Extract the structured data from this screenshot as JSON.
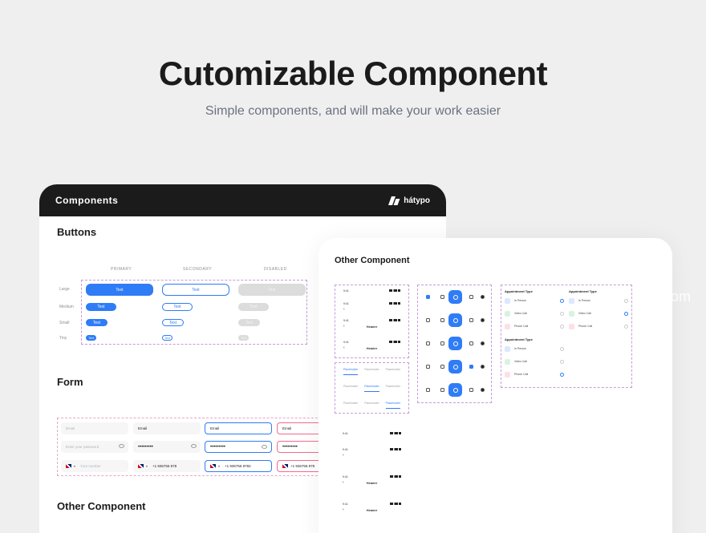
{
  "hero": {
    "title": "Cutomizable Component",
    "subtitle": "Simple components, and will make your work easier"
  },
  "ghost_text": "om",
  "components_card": {
    "header_title": "Components",
    "brand": "hátypo",
    "buttons_section": {
      "title": "Buttons",
      "columns": [
        "PRIMARY",
        "SECONDARY",
        "DISABLED"
      ],
      "rows": [
        "Large",
        "Medium",
        "Small",
        "Tiny"
      ],
      "button_text": "Text"
    },
    "form_section": {
      "title": "Form",
      "fields": {
        "email_placeholder": "Email",
        "email_value": "Email",
        "email_focused": "Email",
        "email_error": "Email",
        "password_placeholder": "Enter your password",
        "password_masked": "•••••••••",
        "phone_placeholder": "Your number",
        "phone_value": "+1 936756 878",
        "phone_focused": "+1 936756 8782",
        "phone_error": "+1 936756 878"
      }
    },
    "other_section_title": "Other Component"
  },
  "other_card": {
    "title": "Other Component",
    "time": "9:41",
    "header_label": "Header",
    "tab_label": "Placeholder",
    "appointment": {
      "heading": "Appointment Type",
      "options": [
        "In Person",
        "Video Call",
        "Phone Call"
      ]
    }
  },
  "colors": {
    "accent": "#2f7cf6",
    "header_bg": "#1b1b1b",
    "page_bg": "#efefef",
    "dashed_outline": "#c89bd9",
    "error": "#f36b8a"
  }
}
